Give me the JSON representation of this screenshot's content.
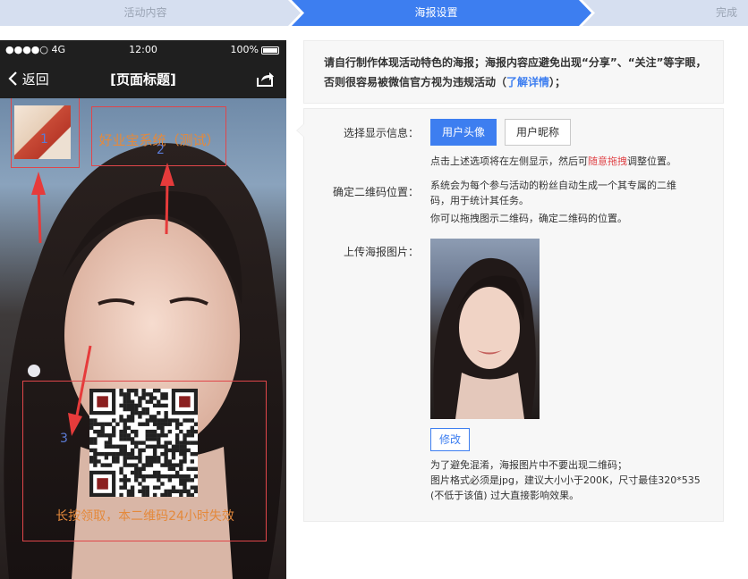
{
  "steps": [
    {
      "label": "活动内容",
      "state": "done"
    },
    {
      "label": "海报设置",
      "state": "active"
    },
    {
      "label": "完成",
      "state": "todo"
    }
  ],
  "colors": {
    "accent": "#3d7ef0",
    "step_inactive": "#d6dff0",
    "highlight_red": "#e0464a",
    "caption_orange": "#e4893b"
  },
  "phone": {
    "status": {
      "signal": "●●●●○ 4G",
      "time": "12:00",
      "battery": "100%"
    },
    "nav": {
      "back_label": "返回",
      "title": "[页面标题]",
      "back_icon": "chevron-left-icon",
      "share_icon": "share-icon"
    },
    "poster": {
      "avatar_number": "1",
      "nickname_number": "2",
      "nickname_text": "好业宝系统（测试）",
      "qr_number": "3",
      "qr_caption": "长按领取，本二维码24小时失效"
    }
  },
  "notice": {
    "line1": "请自行制作体现活动特色的海报；海报内容应避免出现“分享”、“关注”等字眼，",
    "line2_prefix": "否则很容易被微信官方视为违规活动（",
    "link": "了解详情",
    "line2_suffix": "）；"
  },
  "settings": {
    "display_label": "选择显示信息：",
    "btn_avatar": "用户头像",
    "btn_nickname": "用户昵称",
    "display_hint_prefix": "点击上述选项将在左侧显示，然后可",
    "display_hint_red": "随意拖拽",
    "display_hint_suffix": "调整位置。",
    "qr_label": "确定二维码位置：",
    "qr_hint_1": "系统会为每个参与活动的粉丝自动生成一个其专属的二维",
    "qr_hint_2": "码，用于统计其任务。",
    "qr_hint_3": "你可以拖拽图示二维码，确定二维码的位置。",
    "upload_label": "上传海报图片：",
    "btn_edit": "修改",
    "upload_hint_1": "为了避免混淆，海报图片中不要出现二维码；",
    "upload_hint_2": "图片格式必须是jpg，建议大小小于200K，尺寸最佳320*535",
    "upload_hint_3": "(不低于该值) 过大直接影响效果。"
  }
}
